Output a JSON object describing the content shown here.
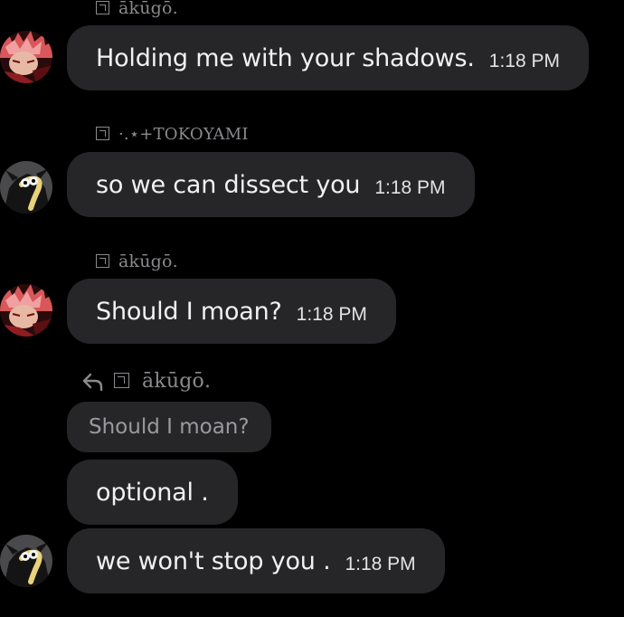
{
  "colors": {
    "background": "#000000",
    "bubble": "#262628",
    "text": "#f1f1f2",
    "muted": "#8a8a8e"
  },
  "messages": [
    {
      "author": "ākūgō.",
      "text": "Holding me with your shadows.",
      "time": "1:18 PM",
      "avatar": "bakugo-avatar"
    },
    {
      "author": "·.⋆+TOKOYAMI",
      "text": "so we can dissect you",
      "time": "1:18 PM",
      "avatar": "tokoyami-avatar"
    },
    {
      "author": "ākūgō.",
      "text": "Should I moan?",
      "time": "1:18 PM",
      "avatar": "bakugo-avatar"
    },
    {
      "reply_to_author": "ākūgō.",
      "reply_to_text": "Should I moan?",
      "text": "optional ."
    },
    {
      "text": "we won't stop you .",
      "time": "1:18 PM",
      "avatar": "tokoyami-avatar"
    }
  ]
}
